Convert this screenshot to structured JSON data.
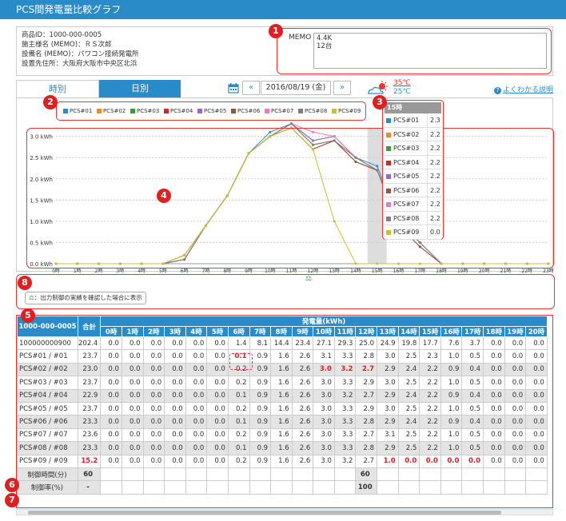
{
  "header": {
    "title": "PCS間発電量比較グラフ"
  },
  "info": {
    "lines": [
      "商品ID：1000-000-0005",
      "施主様名 (MEMO)：ＲＳ次郎",
      "設備名 (MEMO)：パワコン接続発電所",
      "設置先住所：大阪府大阪市中央区北浜"
    ],
    "memo_label": "MEMO",
    "memo_value": "4.4K\n12台"
  },
  "tabs": [
    {
      "label": "時別"
    },
    {
      "label": "日別"
    }
  ],
  "date_nav": {
    "prev": "«",
    "date": "2016/08/19 (金)",
    "next": "»"
  },
  "weather": {
    "high": "35℃",
    "low": "25℃"
  },
  "help": {
    "label": "よくわかる説明"
  },
  "badges": [
    "1",
    "2",
    "3",
    "4",
    "5",
    "6",
    "7",
    "8"
  ],
  "legend": [
    {
      "name": "PCS#01",
      "color": "#2a8bc9"
    },
    {
      "name": "PCS#02",
      "color": "#f08a24"
    },
    {
      "name": "PCS#03",
      "color": "#3a9a3a"
    },
    {
      "name": "PCS#04",
      "color": "#d02828"
    },
    {
      "name": "PCS#05",
      "color": "#9966cc"
    },
    {
      "name": "PCS#06",
      "color": "#8b5a3c"
    },
    {
      "name": "PCS#07",
      "color": "#e87ac0"
    },
    {
      "name": "PCS#08",
      "color": "#808080"
    },
    {
      "name": "PCS#09",
      "color": "#c8c030"
    }
  ],
  "tooltip": {
    "hour": "15時",
    "rows": [
      {
        "name": "PCS#01",
        "value": "2.3"
      },
      {
        "name": "PCS#02",
        "value": "2.2"
      },
      {
        "name": "PCS#03",
        "value": "2.2"
      },
      {
        "name": "PCS#04",
        "value": "2.2"
      },
      {
        "name": "PCS#05",
        "value": "2.2"
      },
      {
        "name": "PCS#06",
        "value": "2.2"
      },
      {
        "name": "PCS#07",
        "value": "2.2"
      },
      {
        "name": "PCS#08",
        "value": "2.2"
      },
      {
        "name": "PCS#09",
        "value": "0.0"
      }
    ]
  },
  "chart_data": {
    "type": "line",
    "x": [
      "0時",
      "1時",
      "2時",
      "3時",
      "4時",
      "5時",
      "6時",
      "7時",
      "8時",
      "9時",
      "10時",
      "11時",
      "12時",
      "13時",
      "14時",
      "15時",
      "16時",
      "17時",
      "18時",
      "19時",
      "20時",
      "21時",
      "22時",
      "23時"
    ],
    "yticks": [
      "0.0 kWh",
      "0.5 kWh",
      "1.0 kWh",
      "1.5 kWh",
      "2.0 kWh",
      "2.5 kWh",
      "3.0 kWh"
    ],
    "ylim": [
      0,
      3.2
    ],
    "highlight_x": "15時",
    "series": [
      {
        "name": "PCS#01",
        "values": [
          0,
          0,
          0,
          0,
          0,
          0,
          0.1,
          0.9,
          1.6,
          2.6,
          3.1,
          3.3,
          2.9,
          3.0,
          2.5,
          2.3,
          1.0,
          0.5,
          0,
          0,
          0,
          0,
          0,
          0
        ]
      },
      {
        "name": "PCS#02",
        "values": [
          0,
          0,
          0,
          0,
          0,
          0,
          0.2,
          0.9,
          1.6,
          2.6,
          3.0,
          3.2,
          2.7,
          2.9,
          2.4,
          2.2,
          1.0,
          0.5,
          0,
          0,
          0,
          0,
          0,
          0
        ]
      },
      {
        "name": "PCS#03",
        "values": [
          0,
          0,
          0,
          0,
          0,
          0,
          0.2,
          0.9,
          1.6,
          2.6,
          3.0,
          3.3,
          2.8,
          2.9,
          2.5,
          2.2,
          1.0,
          0.5,
          0,
          0,
          0,
          0,
          0,
          0
        ]
      },
      {
        "name": "PCS#04",
        "values": [
          0,
          0,
          0,
          0,
          0,
          0,
          0.1,
          0.9,
          1.6,
          2.6,
          3.0,
          3.2,
          2.7,
          2.9,
          2.4,
          2.2,
          0.9,
          0.4,
          0,
          0,
          0,
          0,
          0,
          0
        ]
      },
      {
        "name": "PCS#05",
        "values": [
          0,
          0,
          0,
          0,
          0,
          0,
          0.2,
          0.9,
          1.6,
          2.6,
          3.0,
          3.3,
          2.9,
          3.0,
          2.5,
          2.2,
          1.0,
          0.5,
          0,
          0,
          0,
          0,
          0,
          0
        ]
      },
      {
        "name": "PCS#06",
        "values": [
          0,
          0,
          0,
          0,
          0,
          0,
          0.1,
          0.9,
          1.6,
          2.6,
          3.0,
          3.3,
          2.8,
          2.9,
          2.4,
          2.2,
          0.9,
          0.4,
          0,
          0,
          0,
          0,
          0,
          0
        ]
      },
      {
        "name": "PCS#07",
        "values": [
          0,
          0,
          0,
          0,
          0,
          0,
          0.2,
          0.9,
          1.6,
          2.6,
          3.0,
          3.3,
          3.1,
          3.0,
          2.5,
          2.2,
          1.0,
          0.5,
          0,
          0,
          0,
          0,
          0,
          0
        ]
      },
      {
        "name": "PCS#08",
        "values": [
          0,
          0,
          0,
          0,
          0,
          0,
          0.1,
          0.9,
          1.6,
          2.6,
          3.0,
          3.3,
          2.8,
          2.9,
          2.5,
          2.2,
          1.0,
          0.5,
          0,
          0,
          0,
          0,
          0,
          0
        ]
      },
      {
        "name": "PCS#09",
        "values": [
          0,
          0,
          0,
          0,
          0,
          0,
          0.2,
          0.9,
          1.6,
          2.6,
          3.0,
          3.2,
          2.7,
          1.0,
          0,
          0,
          0,
          0,
          0,
          0,
          0,
          0,
          0,
          0
        ]
      }
    ]
  },
  "control_note": {
    "icon": "⚖",
    "text": "：出力制御の実績を確認した場合に表示"
  },
  "table": {
    "corner": "1000-000-0005",
    "total_header": "合計",
    "group_header": "発電量(kWh)",
    "hours": [
      "0時",
      "1時",
      "2時",
      "3時",
      "4時",
      "5時",
      "6時",
      "7時",
      "8時",
      "9時",
      "10時",
      "11時",
      "12時",
      "13時",
      "14時",
      "15時",
      "16時",
      "17時",
      "18時",
      "19時",
      "20時"
    ],
    "rows": [
      {
        "name": "100000000900",
        "total": "202.4",
        "values": [
          "0.0",
          "0.0",
          "0.0",
          "0.0",
          "0.0",
          "0.0",
          "1.4",
          "8.1",
          "14.4",
          "23.4",
          "27.1",
          "29.3",
          "25.0",
          "24.9",
          "19.8",
          "17.7",
          "7.6",
          "3.7",
          "0.0",
          "0.0",
          "0.0"
        ],
        "red": []
      },
      {
        "name": "PCS#01 / #01",
        "total": "23.7",
        "values": [
          "0.0",
          "0.0",
          "0.0",
          "0.0",
          "0.0",
          "0.0",
          "0.1",
          "0.9",
          "1.6",
          "2.6",
          "3.1",
          "3.3",
          "2.8",
          "3.0",
          "2.5",
          "2.3",
          "1.0",
          "0.5",
          "0.0",
          "0.0",
          "0.0"
        ],
        "red": [
          6
        ]
      },
      {
        "name": "PCS#02 / #02",
        "total": "23.0",
        "values": [
          "0.0",
          "0.0",
          "0.0",
          "0.0",
          "0.0",
          "0.0",
          "0.2",
          "0.9",
          "1.6",
          "2.6",
          "3.0",
          "3.2",
          "2.7",
          "2.9",
          "2.4",
          "2.2",
          "0.9",
          "0.4",
          "0.0",
          "0.0",
          "0.0"
        ],
        "red": [
          10,
          11,
          12
        ]
      },
      {
        "name": "PCS#03 / #03",
        "total": "23.7",
        "values": [
          "0.0",
          "0.0",
          "0.0",
          "0.0",
          "0.0",
          "0.0",
          "0.2",
          "0.9",
          "1.6",
          "2.6",
          "3.0",
          "3.3",
          "2.9",
          "3.0",
          "2.5",
          "2.2",
          "1.0",
          "0.5",
          "0.0",
          "0.0",
          "0.0"
        ],
        "red": []
      },
      {
        "name": "PCS#04 / #04",
        "total": "22.9",
        "values": [
          "0.0",
          "0.0",
          "0.0",
          "0.0",
          "0.0",
          "0.0",
          "0.1",
          "0.9",
          "1.6",
          "2.6",
          "3.0",
          "3.2",
          "2.7",
          "2.9",
          "2.4",
          "2.2",
          "0.9",
          "0.4",
          "0.0",
          "0.0",
          "0.0"
        ],
        "red": []
      },
      {
        "name": "PCS#05 / #05",
        "total": "23.7",
        "values": [
          "0.0",
          "0.0",
          "0.0",
          "0.0",
          "0.0",
          "0.0",
          "0.2",
          "0.9",
          "1.6",
          "2.6",
          "3.0",
          "3.3",
          "2.9",
          "3.0",
          "2.5",
          "2.2",
          "1.0",
          "0.5",
          "0.0",
          "0.0",
          "0.0"
        ],
        "red": []
      },
      {
        "name": "PCS#06 / #06",
        "total": "23.3",
        "values": [
          "0.0",
          "0.0",
          "0.0",
          "0.0",
          "0.0",
          "0.0",
          "0.1",
          "0.9",
          "1.6",
          "2.6",
          "3.0",
          "3.3",
          "2.8",
          "2.9",
          "2.4",
          "2.2",
          "0.9",
          "0.4",
          "0.0",
          "0.0",
          "0.0"
        ],
        "red": []
      },
      {
        "name": "PCS#07 / #07",
        "total": "23.6",
        "values": [
          "0.0",
          "0.0",
          "0.0",
          "0.0",
          "0.0",
          "0.0",
          "0.2",
          "0.9",
          "1.6",
          "2.6",
          "3.0",
          "3.3",
          "2.7",
          "3.1",
          "2.5",
          "2.2",
          "1.0",
          "0.5",
          "0.0",
          "0.0",
          "0.0"
        ],
        "red": []
      },
      {
        "name": "PCS#08 / #08",
        "total": "23.3",
        "values": [
          "0.0",
          "0.0",
          "0.0",
          "0.0",
          "0.0",
          "0.0",
          "0.1",
          "0.9",
          "1.6",
          "2.6",
          "3.0",
          "3.3",
          "2.8",
          "2.9",
          "2.5",
          "2.2",
          "1.0",
          "0.5",
          "0.0",
          "0.0",
          "0.0"
        ],
        "red": []
      },
      {
        "name": "PCS#09 / #09",
        "total": "15.2",
        "values": [
          "0.0",
          "0.0",
          "0.0",
          "0.0",
          "0.0",
          "0.0",
          "0.2",
          "0.9",
          "1.6",
          "2.6",
          "3.0",
          "3.2",
          "2.7",
          "1.0",
          "0.0",
          "0.0",
          "0.0",
          "0.0",
          "0.0",
          "0.0",
          "0.0"
        ],
        "red": [
          13,
          14,
          15,
          16,
          17
        ],
        "total_red": true
      }
    ],
    "control_time": {
      "label": "制御時間(分)",
      "total": "60",
      "values": [
        "",
        "",
        "",
        "",
        "",
        "",
        "",
        "",
        "",
        "",
        "",
        "",
        "60",
        "",
        "",
        "",
        "",
        "",
        "",
        "",
        ""
      ]
    },
    "control_rate": {
      "label": "制御率(%)",
      "total": "-",
      "values": [
        "",
        "",
        "",
        "",
        "",
        "",
        "",
        "",
        "",
        "",
        "",
        "",
        "100",
        "",
        "",
        "",
        "",
        "",
        "",
        "",
        ""
      ]
    }
  }
}
